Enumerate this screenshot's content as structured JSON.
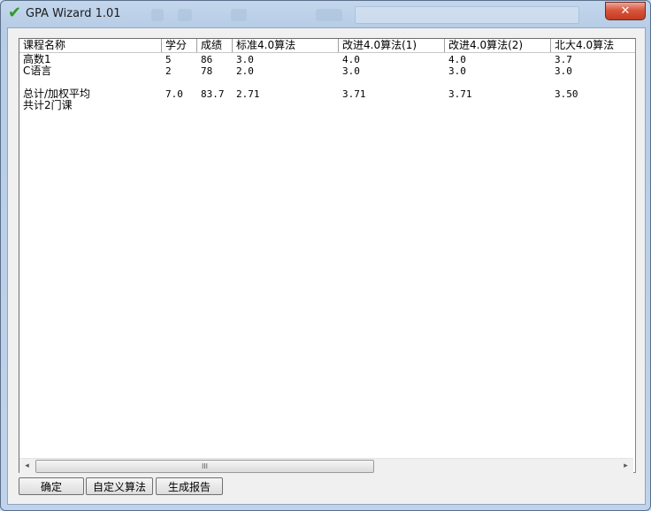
{
  "window": {
    "title": "GPA Wizard 1.01",
    "close_label": "✕"
  },
  "table": {
    "columns": [
      "课程名称",
      "学分",
      "成绩",
      "标准4.0算法",
      "改进4.0算法(1)",
      "改进4.0算法(2)",
      "北大4.0算法"
    ],
    "rows": [
      [
        "高数1",
        "5",
        "86",
        "3.0",
        "4.0",
        "4.0",
        "3.7"
      ],
      [
        "C语言",
        "2",
        "78",
        "2.0",
        "3.0",
        "3.0",
        "3.0"
      ],
      [
        "",
        "",
        "",
        "",
        "",
        "",
        ""
      ],
      [
        "总计/加权平均",
        "7.0",
        "83.7",
        "2.71",
        "3.71",
        "3.71",
        "3.50"
      ],
      [
        "共计2门课",
        "",
        "",
        "",
        "",
        "",
        ""
      ]
    ]
  },
  "scrollbar": {
    "left_arrow": "◂",
    "right_arrow": "▸",
    "thumb_grip": "III"
  },
  "buttons": {
    "ok": "确定",
    "custom_algorithm": "自定义算法",
    "generate_report": "生成报告"
  },
  "colors": {
    "title_icon": "#2f9a23",
    "close_button": "#c33b22"
  }
}
